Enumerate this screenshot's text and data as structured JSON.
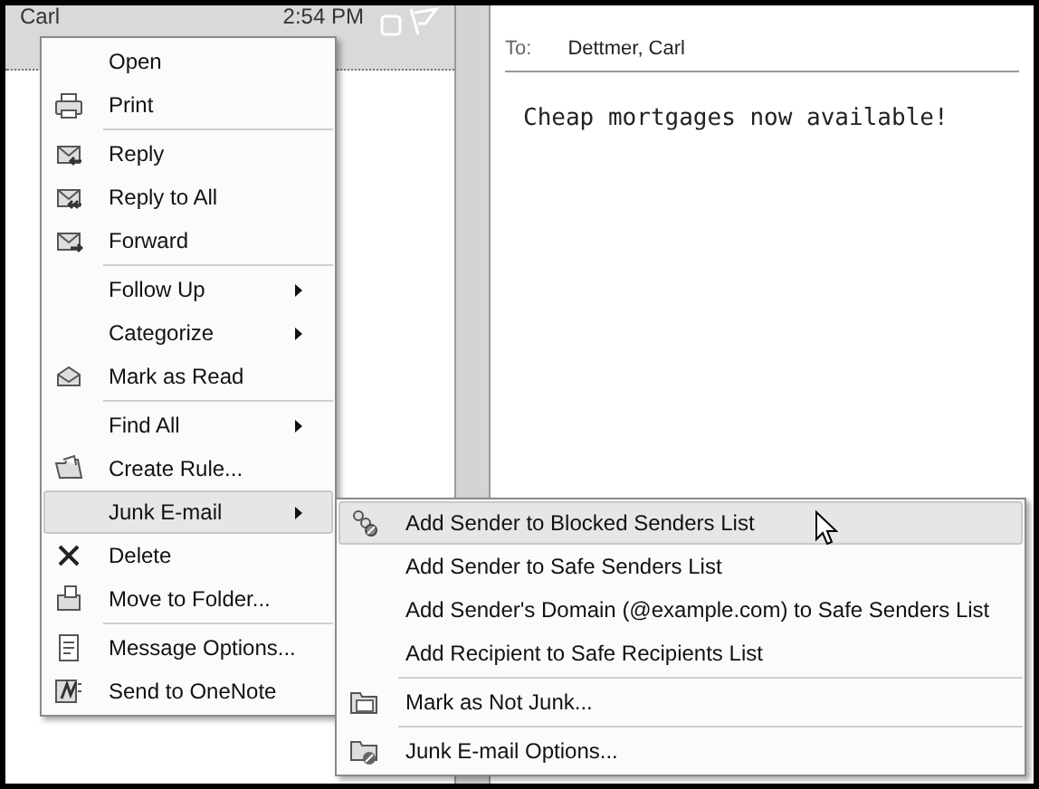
{
  "message_list": {
    "sender": "Carl",
    "time": "2:54 PM"
  },
  "reading_pane": {
    "to_label": "To:",
    "to_value": "Dettmer, Carl",
    "body": "Cheap mortgages now available!"
  },
  "context_menu": [
    {
      "kind": "item",
      "label": "Open",
      "submenu": false,
      "selected": false
    },
    {
      "kind": "item",
      "label": "Print",
      "submenu": false,
      "selected": false
    },
    {
      "kind": "separator"
    },
    {
      "kind": "item",
      "label": "Reply",
      "submenu": false,
      "selected": false
    },
    {
      "kind": "item",
      "label": "Reply to All",
      "submenu": false,
      "selected": false
    },
    {
      "kind": "item",
      "label": "Forward",
      "submenu": false,
      "selected": false
    },
    {
      "kind": "separator"
    },
    {
      "kind": "item",
      "label": "Follow Up",
      "submenu": true,
      "selected": false
    },
    {
      "kind": "item",
      "label": "Categorize",
      "submenu": true,
      "selected": false
    },
    {
      "kind": "item",
      "label": "Mark as Read",
      "submenu": false,
      "selected": false
    },
    {
      "kind": "separator"
    },
    {
      "kind": "item",
      "label": "Find All",
      "submenu": true,
      "selected": false
    },
    {
      "kind": "item",
      "label": "Create Rule...",
      "submenu": false,
      "selected": false
    },
    {
      "kind": "item",
      "label": "Junk E-mail",
      "submenu": true,
      "selected": true
    },
    {
      "kind": "item",
      "label": "Delete",
      "submenu": false,
      "selected": false
    },
    {
      "kind": "item",
      "label": "Move to Folder...",
      "submenu": false,
      "selected": false
    },
    {
      "kind": "separator"
    },
    {
      "kind": "item",
      "label": "Message Options...",
      "submenu": false,
      "selected": false
    },
    {
      "kind": "item",
      "label": "Send to OneNote",
      "submenu": false,
      "selected": false
    }
  ],
  "junk_submenu": [
    {
      "kind": "item",
      "label": "Add Sender to Blocked Senders List",
      "selected": true
    },
    {
      "kind": "item",
      "label": "Add Sender to Safe Senders List",
      "selected": false
    },
    {
      "kind": "item",
      "label": "Add Sender's Domain (@example.com) to Safe Senders List",
      "selected": false
    },
    {
      "kind": "item",
      "label": "Add Recipient to Safe Recipients List",
      "selected": false
    },
    {
      "kind": "separator"
    },
    {
      "kind": "item",
      "label": "Mark as Not Junk...",
      "selected": false
    },
    {
      "kind": "separator"
    },
    {
      "kind": "item",
      "label": "Junk E-mail Options...",
      "selected": false
    }
  ]
}
